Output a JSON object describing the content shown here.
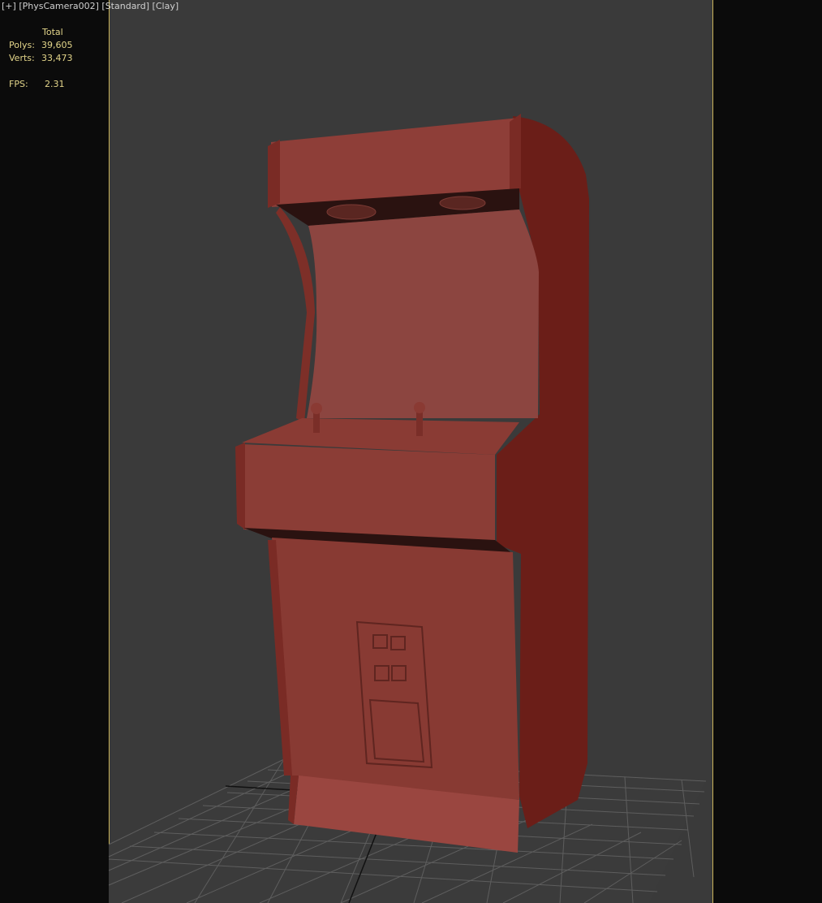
{
  "viewport_label": {
    "plus": "[+]",
    "camera": "[PhysCamera002]",
    "shading_style": "[Standard]",
    "render_mode": "[Clay]"
  },
  "stats": {
    "column_header": "Total",
    "polys_label": "Polys:",
    "polys_value": "39,605",
    "verts_label": "Verts:",
    "verts_value": "33,473",
    "fps_label": "FPS:",
    "fps_value": "2.31"
  },
  "colors": {
    "background": "#3a3a3a",
    "letterbox": "#0b0b0b",
    "safe_frame_border": "#c9b45a",
    "stats_text": "#e3d58a",
    "clay_front": "#8a3c36",
    "clay_side": "#6b1e18",
    "grid_line": "#5c5c5c"
  },
  "scene_object": {
    "icon": "arcade-cabinet-model"
  }
}
